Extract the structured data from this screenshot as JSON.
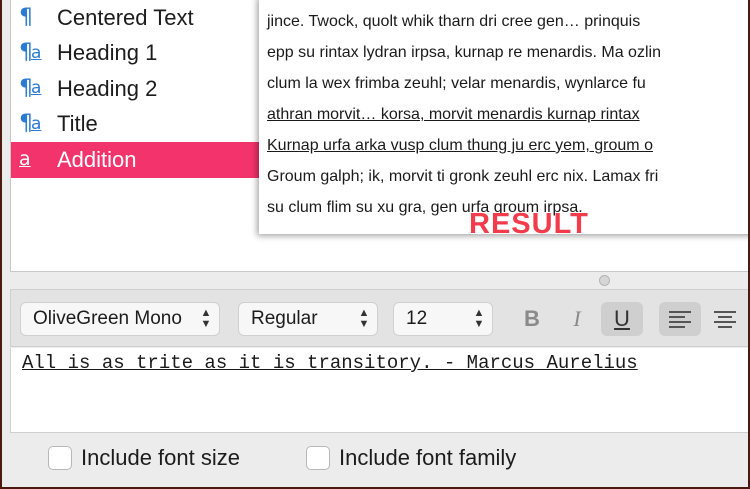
{
  "styles": [
    {
      "label": "Centered Text",
      "icon": "paragraph-icon",
      "selected": false
    },
    {
      "label": "Heading 1",
      "icon": "paragraph-char-style-icon",
      "selected": false
    },
    {
      "label": "Heading 2",
      "icon": "paragraph-char-style-icon",
      "selected": false
    },
    {
      "label": "Title",
      "icon": "paragraph-char-style-icon",
      "selected": false
    },
    {
      "label": "Addition",
      "icon": "char-style-icon",
      "selected": true
    }
  ],
  "preview": {
    "lines": [
      {
        "text": "jince. Twock, quolt whik tharn dri cree gen… prinquis",
        "underline": false
      },
      {
        "text": "epp su rintax lydran irpsa, kurnap re menardis. Ma ozlin",
        "underline": false
      },
      {
        "text": "clum la wex frimba zeuhl; velar menardis, wynlarce fu",
        "underline": false
      },
      {
        "text": "athran morvit… korsa, morvit menardis kurnap rintax",
        "underline": true
      },
      {
        "text": "Kurnap urfa arka vusp clum thung ju erc yem, groum o",
        "underline": true
      },
      {
        "text": "Groum galph; ik, morvit ti gronk zeuhl erc nix. Lamax fri",
        "underline": false
      },
      {
        "text": "su clum flim su xu gra, gen urfa groum irpsa.",
        "underline": false
      }
    ],
    "result_label": "RESULT"
  },
  "toolbar": {
    "font_family": "OliveGreen Mono",
    "font_weight": "Regular",
    "font_size": "12",
    "bold_label": "B",
    "italic_label": "I",
    "underline_label": "U",
    "underline_active": true,
    "align_left_active": true
  },
  "editor": {
    "sample_text": "All is as trite as it is transitory. - Marcus Aurelius"
  },
  "options": {
    "include_font_size": "Include font size",
    "include_font_family": "Include font family"
  },
  "colors": {
    "selection": "#f3336b",
    "icon_blue": "#2a7bd4",
    "result_red": "#f23b4b"
  }
}
